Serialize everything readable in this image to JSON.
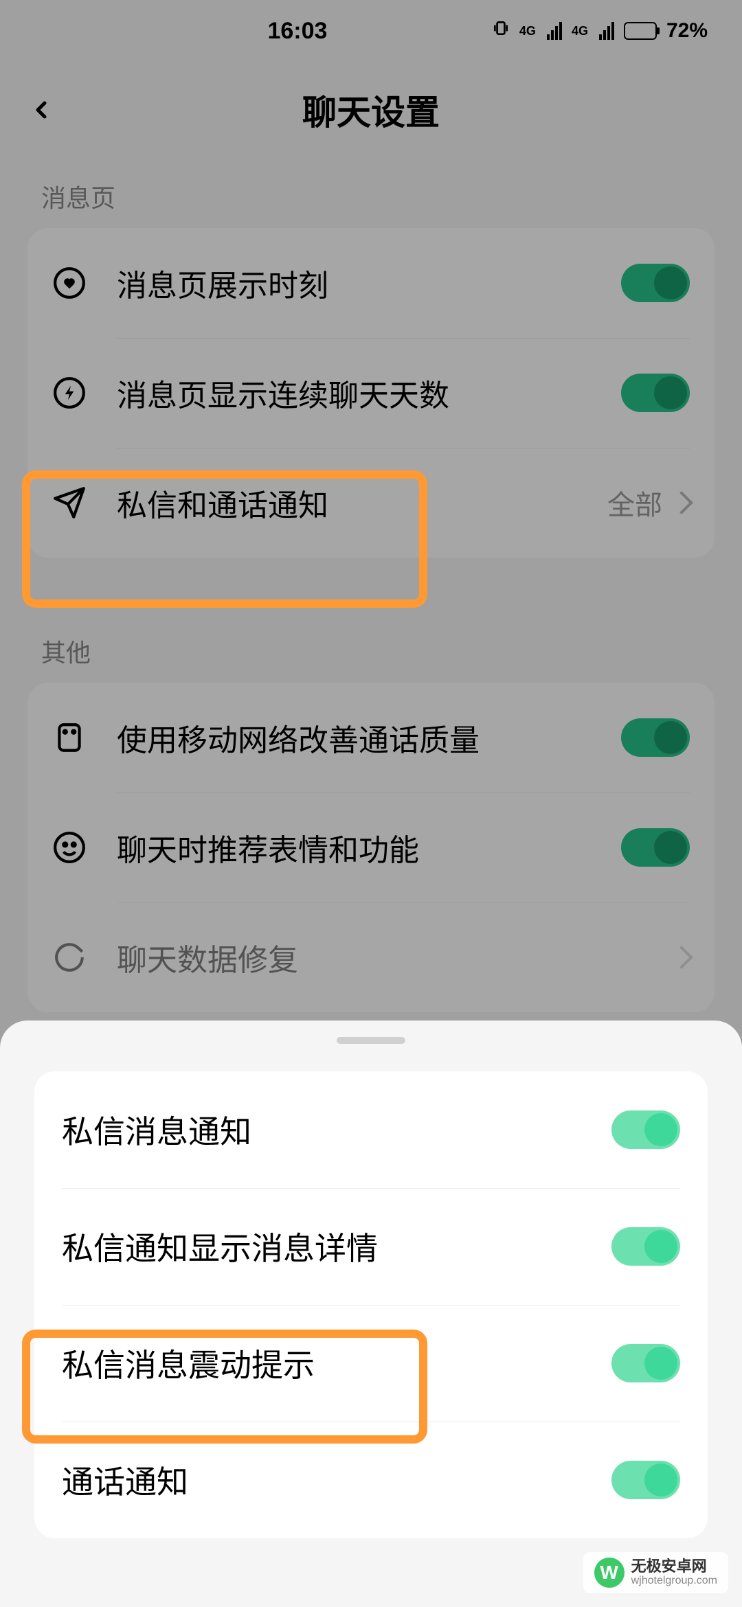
{
  "status": {
    "time": "16:03",
    "network_label": "4G",
    "battery_percent": "72%"
  },
  "header": {
    "title": "聊天设置"
  },
  "section_messages": {
    "label": "消息页",
    "items": [
      {
        "label": "消息页展示时刻",
        "type": "toggle",
        "on": true
      },
      {
        "label": "消息页显示连续聊天天数",
        "type": "toggle",
        "on": true
      },
      {
        "label": "私信和通话通知",
        "type": "link",
        "value": "全部"
      }
    ]
  },
  "section_other": {
    "label": "其他",
    "items": [
      {
        "label": "使用移动网络改善通话质量",
        "type": "toggle",
        "on": true
      },
      {
        "label": "聊天时推荐表情和功能",
        "type": "toggle",
        "on": true
      },
      {
        "label": "聊天数据修复",
        "type": "link"
      }
    ]
  },
  "sheet": {
    "items": [
      {
        "label": "私信消息通知",
        "on": true
      },
      {
        "label": "私信通知显示消息详情",
        "on": true
      },
      {
        "label": "私信消息震动提示",
        "on": true
      },
      {
        "label": "通话通知",
        "on": true
      }
    ]
  },
  "watermark": {
    "title": "无极安卓网",
    "url": "wjhotelgroup.com"
  }
}
